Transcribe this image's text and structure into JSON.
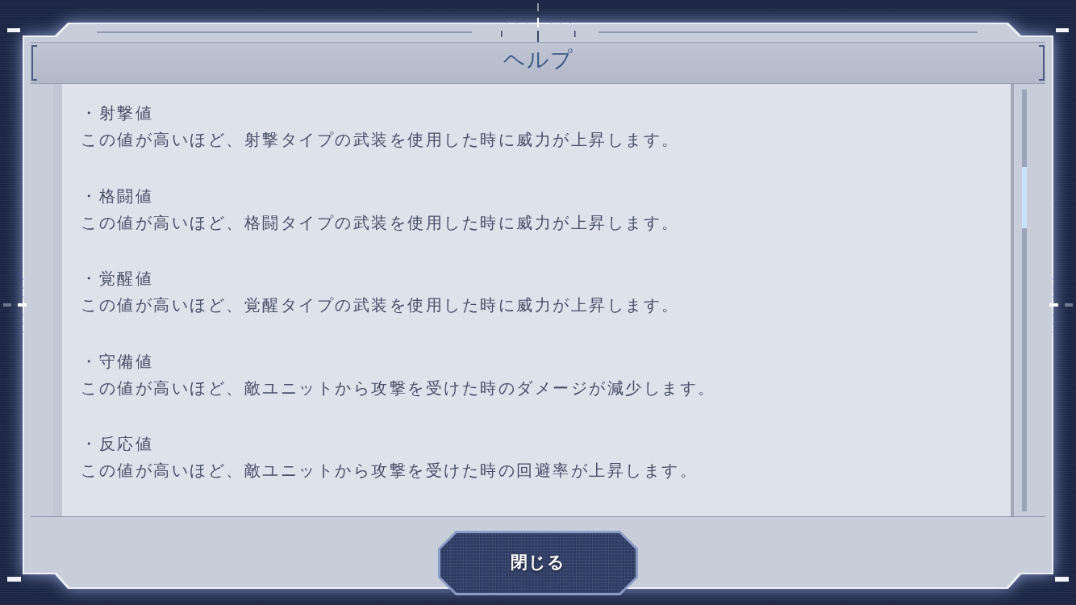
{
  "dialog": {
    "title": "ヘルプ",
    "items": [
      {
        "heading": "・射撃値",
        "description": "この値が高いほど、射撃タイプの武装を使用した時に威力が上昇します。"
      },
      {
        "heading": "・格闘値",
        "description": "この値が高いほど、格闘タイプの武装を使用した時に威力が上昇します。"
      },
      {
        "heading": "・覚醒値",
        "description": "この値が高いほど、覚醒タイプの武装を使用した時に威力が上昇します。"
      },
      {
        "heading": "・守備値",
        "description": "この値が高いほど、敵ユニットから攻撃を受けた時のダメージが減少します。"
      },
      {
        "heading": "・反応値",
        "description": "この値が高いほど、敵ユニットから攻撃を受けた時の回避率が上昇します。"
      }
    ],
    "close_button": {
      "label": "閉じる"
    }
  }
}
